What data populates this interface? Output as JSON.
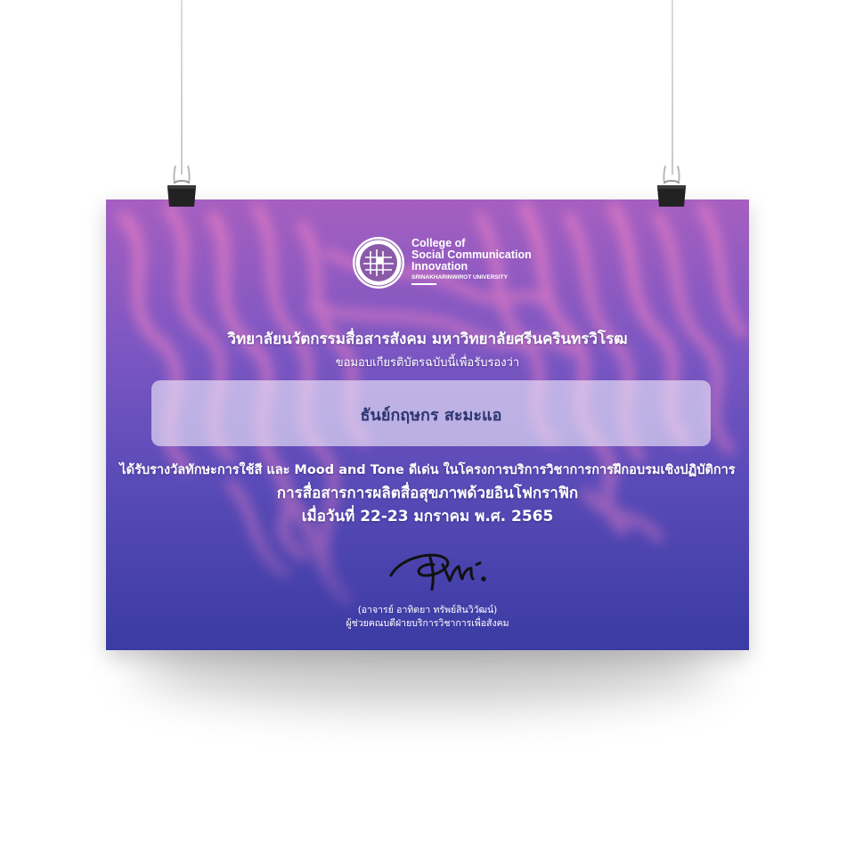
{
  "colors": {
    "poster_top": "#a55fc0",
    "poster_bottom": "#3a3ba3",
    "wave": "#e27bc4",
    "name_text": "#2d3572",
    "text": "#ffffff"
  },
  "logo": {
    "line1": "College of",
    "line2": "Social Communication",
    "line3": "Innovation",
    "university": "SRINAKHARINWIROT UNIVERSITY",
    "icon": "college-seal-icon"
  },
  "certificate": {
    "org": "วิทยาลัยนวัตกรรมสื่อสารสังคม มหาวิทยาลัยศรีนครินทรวิโรฒ",
    "intro": "ขอมอบเกียรติบัตรฉบับนี้เพื่อรับรองว่า",
    "name": "ธันย์กฤษกร สะมะแอ",
    "award": "ได้รับรางวัลทักษะการใช้สี และ Mood and Tone ดีเด่น  ในโครงการบริการวิชาการการฝึกอบรมเชิงปฏิบัติการ",
    "course": "การสื่อสารการผลิตสื่อสุขภาพด้วยอินโฟกราฟิก",
    "date": "เมื่อวันที่ 22-23 มกราคม พ.ศ. 2565",
    "signer": "(อาจารย์ อาทิตยา ทรัพย์สินวิวัฒน์)",
    "position": "ผู้ช่วยคณบดีฝ่ายบริการวิชาการเพื่อสังคม"
  }
}
